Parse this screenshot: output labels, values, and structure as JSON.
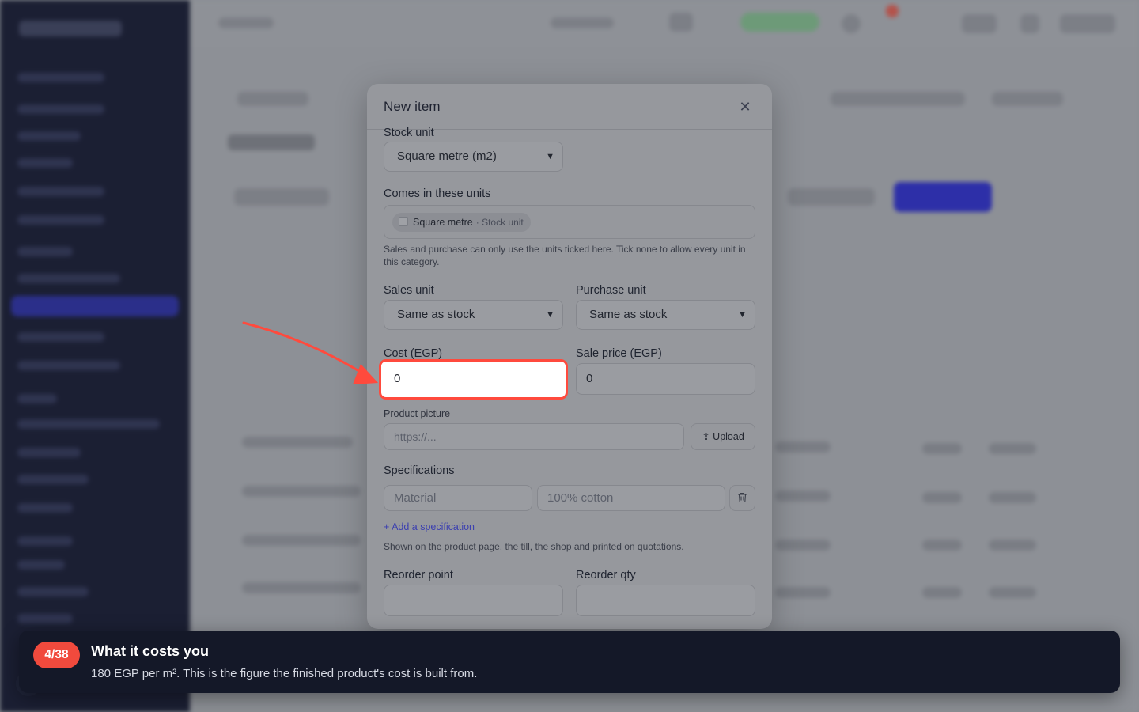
{
  "modal": {
    "title": "New item",
    "close_icon": "close-icon",
    "stock_unit": {
      "label": "Stock unit",
      "value": "Square metre (m2)"
    },
    "comes_in": {
      "label": "Comes in these units",
      "chip_label": "Square metre",
      "chip_sub": "· Stock unit",
      "help": "Sales and purchase can only use the units ticked here. Tick none to allow every unit in this category."
    },
    "sales_unit": {
      "label": "Sales unit",
      "value": "Same as stock"
    },
    "purchase_unit": {
      "label": "Purchase unit",
      "value": "Same as stock"
    },
    "cost": {
      "label": "Cost (EGP)",
      "value": "0"
    },
    "sale_price": {
      "label": "Sale price (EGP)",
      "value": "0"
    },
    "product_picture": {
      "label": "Product picture",
      "placeholder": "https://...",
      "upload_label": "Upload"
    },
    "specifications": {
      "label": "Specifications",
      "name_placeholder": "Material",
      "value_placeholder": "100% cotton",
      "add_link": "+ Add a specification",
      "help": "Shown on the product page, the till, the shop and printed on quotations."
    },
    "reorder_point": {
      "label": "Reorder point",
      "value": ""
    },
    "reorder_qty": {
      "label": "Reorder qty",
      "value": ""
    }
  },
  "tour": {
    "step": "4/38",
    "title": "What it costs you",
    "description": "180 EGP per m². This is the figure the finished product's cost is built from."
  },
  "colors": {
    "highlight": "#ff4a3d",
    "badge": "#f14a3d",
    "tour_bg": "#141828",
    "sidebar_bg": "#1b1f33",
    "primary": "#2d2fa8"
  }
}
